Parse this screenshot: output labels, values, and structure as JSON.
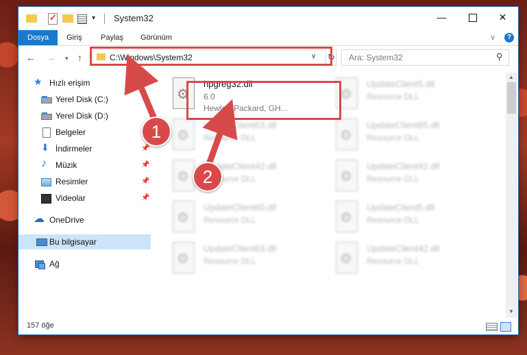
{
  "window": {
    "title": "System32",
    "quick_access_dropdown": "▾",
    "minimize": "—",
    "close": "✕"
  },
  "ribbon": {
    "tabs": [
      {
        "label": "Dosya"
      },
      {
        "label": "Giriş"
      },
      {
        "label": "Paylaş"
      },
      {
        "label": "Görünüm"
      }
    ],
    "chevron": "∨",
    "help": "?"
  },
  "navigation": {
    "back": "←",
    "forward": "→",
    "recent": "▾",
    "up": "↑",
    "address": "C:\\Windows\\System32",
    "address_chevron": "∨",
    "refresh": "↻",
    "search_placeholder": "Ara: System32",
    "search_icon": "⚲"
  },
  "sidebar": {
    "items": [
      {
        "label": "Hızlı erişim",
        "icon": "star-icon"
      },
      {
        "label": "Yerel Disk (C:)",
        "icon": "drive-icon"
      },
      {
        "label": "Yerel Disk (D:)",
        "icon": "drive-icon"
      },
      {
        "label": "Belgeler",
        "icon": "documents-icon"
      },
      {
        "label": "İndirmeler",
        "icon": "download-icon",
        "pinned": true
      },
      {
        "label": "Müzik",
        "icon": "music-icon",
        "pinned": true
      },
      {
        "label": "Resimler",
        "icon": "pictures-icon",
        "pinned": true
      },
      {
        "label": "Videolar",
        "icon": "video-icon",
        "pinned": true
      },
      {
        "label": "OneDrive",
        "icon": "cloud-icon"
      },
      {
        "label": "Bu bilgisayar",
        "icon": "computer-icon",
        "selected": true
      },
      {
        "label": "Ağ",
        "icon": "network-icon"
      }
    ],
    "pin_glyph": "📌"
  },
  "files": [
    {
      "name": "hpgreg32.dll",
      "desc": "6.0",
      "company": "Hewlett-Packard, GH..."
    },
    {
      "name": "UpdateClient5.dll",
      "desc": "Resource DLL"
    },
    {
      "name": "UpdateClient63.dll",
      "desc": "Resource DLL"
    },
    {
      "name": "UpdateClient65.dll",
      "desc": "Resource DLL"
    },
    {
      "name": "UpdateClient42.dll",
      "desc": "Resource DLL"
    },
    {
      "name": "UpdateClient42.dll",
      "desc": "Resource DLL"
    },
    {
      "name": "UpdateClient65.dll",
      "desc": "Resource DLL"
    },
    {
      "name": "UpdateClient5.dll",
      "desc": "Resource DLL"
    },
    {
      "name": "UpdateClient63.dll",
      "desc": "Resource DLL"
    },
    {
      "name": "UpdateClient42.dll",
      "desc": "Resource DLL"
    }
  ],
  "status": {
    "item_count": "157 öğe"
  },
  "annotations": {
    "step1": "1",
    "step2": "2",
    "color": "#d74a4a"
  }
}
